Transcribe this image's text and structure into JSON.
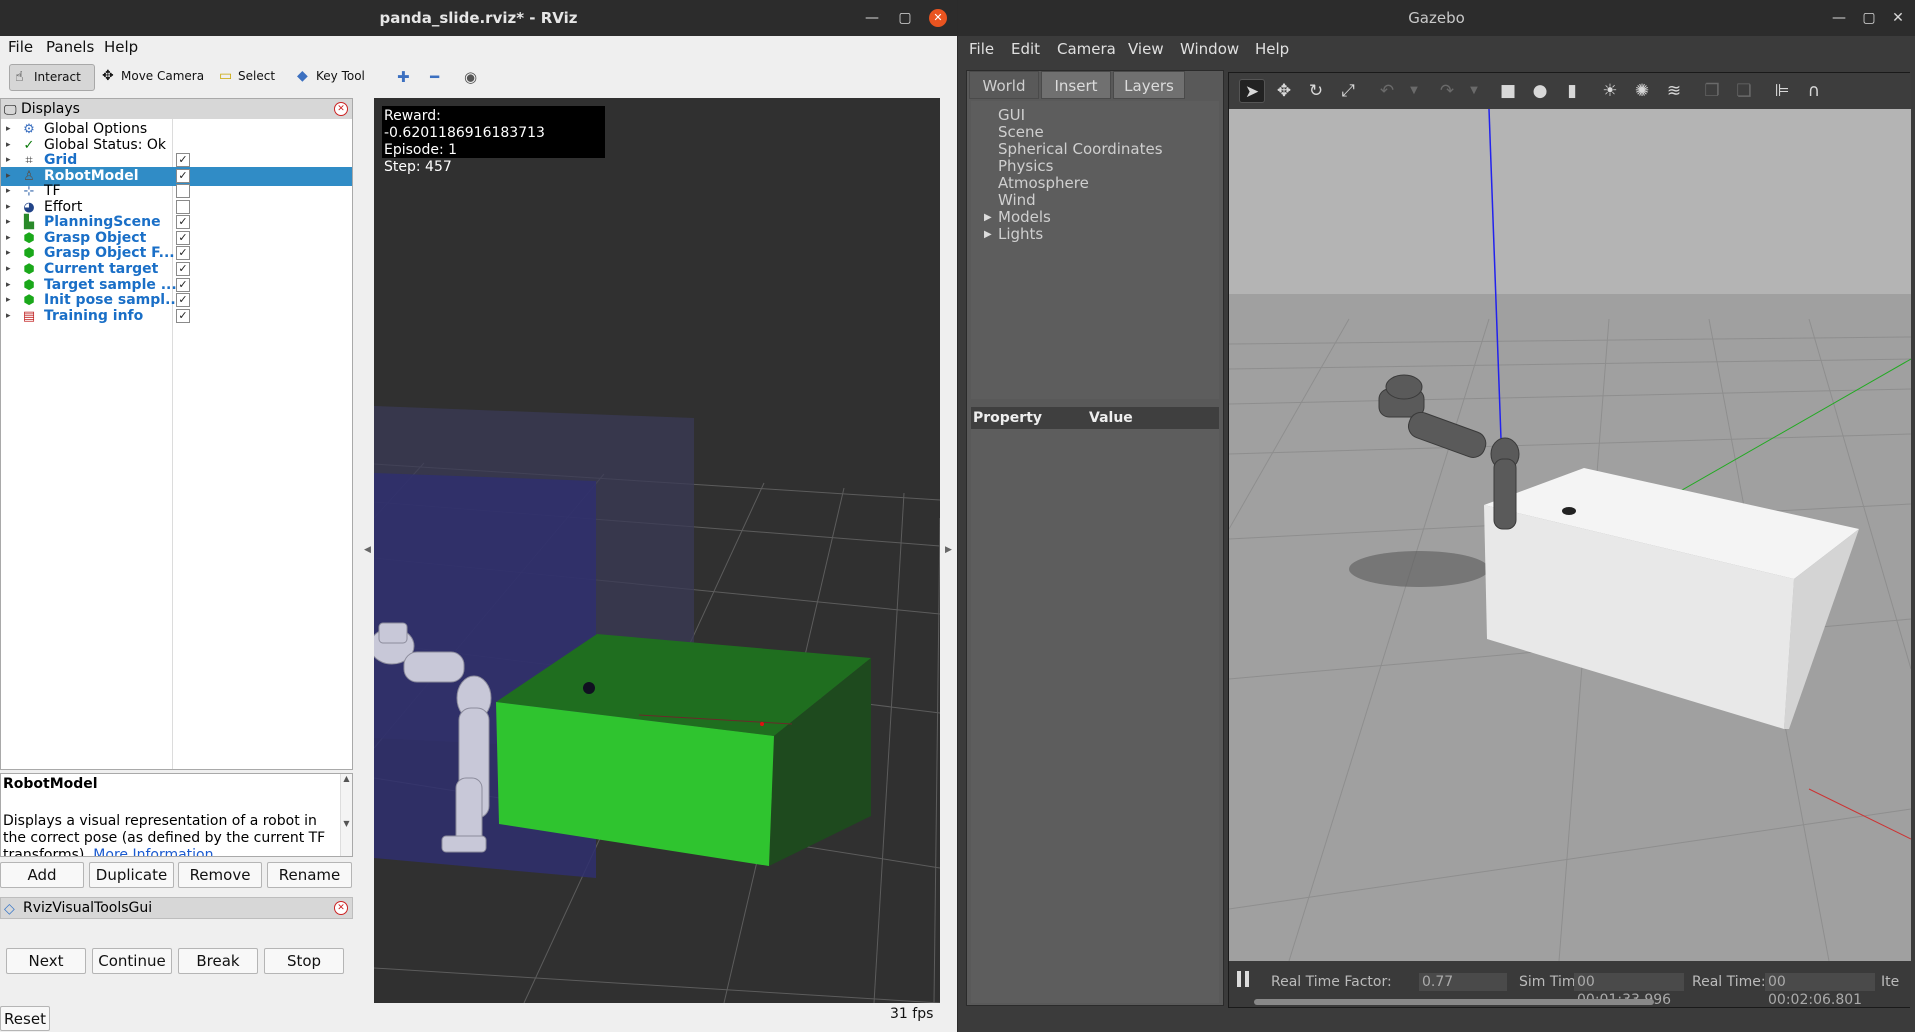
{
  "rviz": {
    "window_title": "panda_slide.rviz* - RViz",
    "menu": [
      "File",
      "Panels",
      "Help"
    ],
    "toolbar": {
      "interact": "Interact",
      "move_camera": "Move Camera",
      "select": "Select",
      "key_tool": "Key Tool"
    },
    "displays_panel": {
      "title": "Displays",
      "items": [
        {
          "label": "Global Options",
          "icon": "gear-icon",
          "checked": null,
          "bold": false
        },
        {
          "label": "Global Status: Ok",
          "icon": "check-icon",
          "checked": null,
          "bold": false
        },
        {
          "label": "Grid",
          "icon": "grid-icon",
          "checked": true,
          "bold": true
        },
        {
          "label": "RobotModel",
          "icon": "robot-icon",
          "checked": true,
          "bold": true,
          "selected": true
        },
        {
          "label": "TF",
          "icon": "axes-icon",
          "checked": false,
          "bold": false
        },
        {
          "label": "Effort",
          "icon": "effort-icon",
          "checked": false,
          "bold": false
        },
        {
          "label": "PlanningScene",
          "icon": "scene-icon",
          "checked": true,
          "bold": true
        },
        {
          "label": "Grasp Object",
          "icon": "marker-icon",
          "checked": true,
          "bold": true
        },
        {
          "label": "Grasp Object F...",
          "icon": "marker-icon",
          "checked": true,
          "bold": true
        },
        {
          "label": "Current target",
          "icon": "marker-icon",
          "checked": true,
          "bold": true
        },
        {
          "label": "Target sample ...",
          "icon": "marker-icon",
          "checked": true,
          "bold": true
        },
        {
          "label": "Init pose sampl...",
          "icon": "marker-icon",
          "checked": true,
          "bold": true
        },
        {
          "label": "Training info",
          "icon": "text-marker-icon",
          "checked": true,
          "bold": true
        }
      ]
    },
    "description": {
      "title": "RobotModel",
      "text": "Displays a visual representation of a robot in the correct pose (as defined by the current TF transforms).",
      "link": "More Information."
    },
    "panel_buttons": {
      "add": "Add",
      "duplicate": "Duplicate",
      "remove": "Remove",
      "rename": "Rename"
    },
    "visual_tools": {
      "title": "RvizVisualToolsGui",
      "next": "Next",
      "continue": "Continue",
      "break": "Break",
      "stop": "Stop"
    },
    "reset": "Reset",
    "overlay": {
      "reward": "Reward: -0.6201186916183713",
      "episode": "Episode: 1",
      "step": "Step: 457"
    },
    "fps": "31 fps"
  },
  "gazebo": {
    "window_title": "Gazebo",
    "menu": [
      "File",
      "Edit",
      "Camera",
      "View",
      "Window",
      "Help"
    ],
    "tabs": [
      "World",
      "Insert",
      "Layers"
    ],
    "world_tree": [
      "GUI",
      "Scene",
      "Spherical Coordinates",
      "Physics",
      "Atmosphere",
      "Wind",
      "Models",
      "Lights"
    ],
    "property_header": {
      "property": "Property",
      "value": "Value"
    },
    "status": {
      "rtf_label": "Real Time Factor:",
      "rtf_value": "0.77",
      "sim_label": "Sim Time:",
      "sim_value": "00 00:01:33.996",
      "real_label": "Real Time:",
      "real_value": "00 00:02:06.801",
      "iter_label": "Ite"
    }
  }
}
